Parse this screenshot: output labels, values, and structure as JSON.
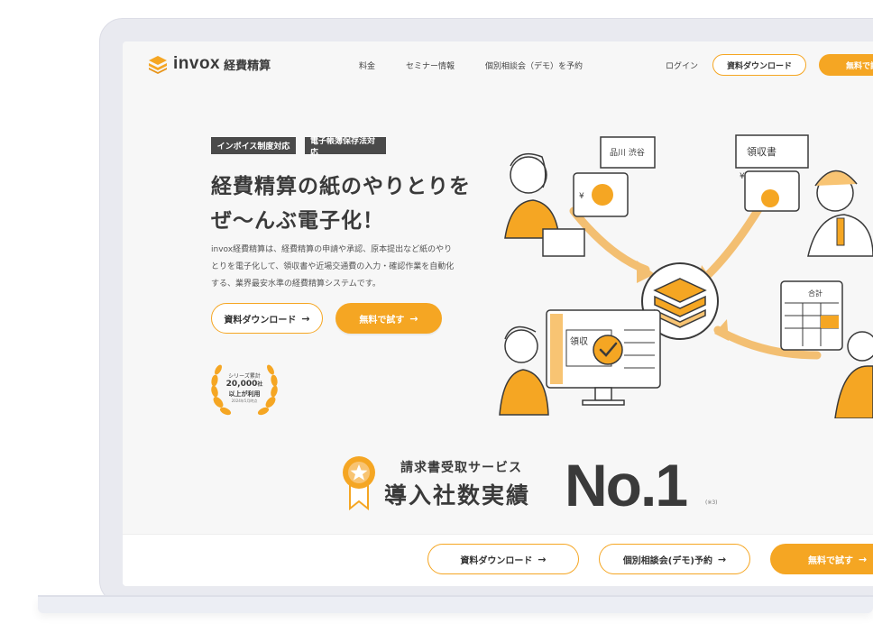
{
  "colors": {
    "accent": "#f5a623",
    "dark": "#3a3a3a",
    "badge_bg": "#4a4a4a",
    "screen_bg": "#f7f7f7"
  },
  "header": {
    "logo_text": "invox",
    "logo_sub": "経費精算",
    "nav": [
      "料金",
      "セミナー情報",
      "個別相談会（デモ）を予約"
    ],
    "login": "ログイン",
    "download_label": "資料ダウンロード",
    "trial_label": "無料で試"
  },
  "hero": {
    "badges": [
      "インボイス制度対応",
      "電子帳簿保存法対応"
    ],
    "headline_line1": "経費精算の紙のやりとりを",
    "headline_line2": "ぜ〜んぶ電子化！",
    "description": "invox経費精算は、経費精算の申請や承認、原本提出など紙のやりとりを電子化して、領収書や近場交通費の入力・確認作業を自動化する、業界最安水準の経費精算システムです。",
    "cta_download": "資料ダウンロード",
    "cta_trial": "無料で試す",
    "arrow": "→"
  },
  "award": {
    "line1": "シリーズ累計",
    "number": "20,000",
    "unit": "社",
    "line3": "以上が利用",
    "note": "2024年5月時点"
  },
  "no1": {
    "sub": "請求書受取サービス",
    "main": "導入社数実績",
    "big": "No.1",
    "note": "(※3)"
  },
  "illustration": {
    "receipt_label": "領収書",
    "ticket_label": "品川 渋谷",
    "receipt_short": "領収",
    "total_label": "合計",
    "yen": "¥"
  },
  "bottom_bar": {
    "download": "資料ダウンロード",
    "consult": "個別相談会(デモ)予約",
    "trial": "無料で試す",
    "arrow": "→"
  }
}
